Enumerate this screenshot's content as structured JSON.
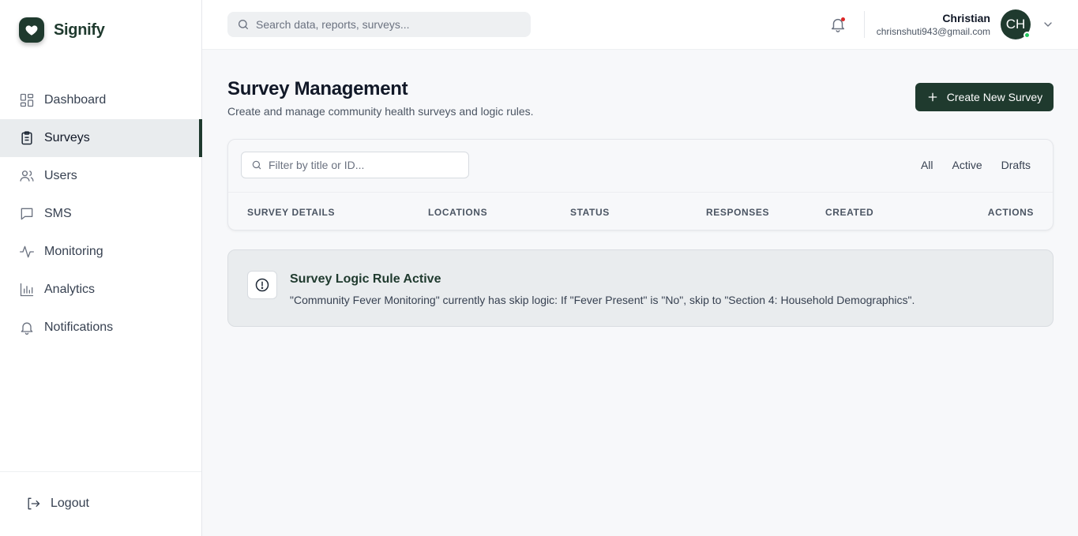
{
  "brand": {
    "name": "Signify"
  },
  "sidebar": {
    "items": [
      {
        "label": "Dashboard",
        "icon": "dashboard-icon",
        "active": false
      },
      {
        "label": "Surveys",
        "icon": "clipboard-icon",
        "active": true
      },
      {
        "label": "Users",
        "icon": "users-icon",
        "active": false
      },
      {
        "label": "SMS",
        "icon": "message-icon",
        "active": false
      },
      {
        "label": "Monitoring",
        "icon": "activity-icon",
        "active": false
      },
      {
        "label": "Analytics",
        "icon": "bar-chart-icon",
        "active": false
      },
      {
        "label": "Notifications",
        "icon": "bell-icon",
        "active": false
      }
    ],
    "logout_label": "Logout"
  },
  "topbar": {
    "search_placeholder": "Search data, reports, surveys...",
    "user": {
      "name": "Christian",
      "email": "chrisnshuti943@gmail.com",
      "initials": "CH"
    }
  },
  "page": {
    "title": "Survey Management",
    "subtitle": "Create and manage community health surveys and logic rules.",
    "create_button_label": "Create New Survey"
  },
  "table": {
    "filter_placeholder": "Filter by title or ID...",
    "filters": [
      "All",
      "Active",
      "Drafts"
    ],
    "columns": [
      "Survey Details",
      "Locations",
      "Status",
      "Responses",
      "Created",
      "Actions"
    ]
  },
  "notice": {
    "title": "Survey Logic Rule Active",
    "text": "\"Community Fever Monitoring\" currently has skip logic: If \"Fever Present\" is \"No\", skip to \"Section 4: Household Demographics\"."
  },
  "colors": {
    "primary": "#1f3a2e",
    "active_nav_bg": "#e9ecee",
    "notification_dot": "#dc2626",
    "online_status": "#22c55e"
  }
}
